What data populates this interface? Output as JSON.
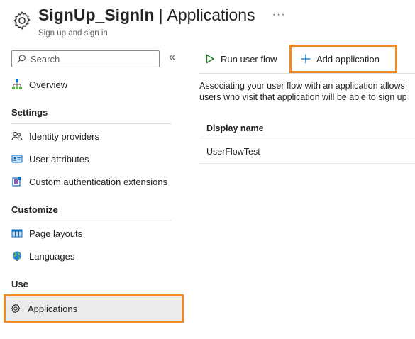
{
  "header": {
    "title": "SignUp_SignIn",
    "separator": "|",
    "page": "Applications",
    "more": "···",
    "subtitle": "Sign up and sign in"
  },
  "sidebar": {
    "search_placeholder": "Search",
    "collapse": "«",
    "items": {
      "overview": "Overview",
      "identity_providers": "Identity providers",
      "user_attributes": "User attributes",
      "custom_auth": "Custom authentication extensions",
      "page_layouts": "Page layouts",
      "languages": "Languages",
      "applications": "Applications"
    },
    "sections": {
      "settings": "Settings",
      "customize": "Customize",
      "use": "Use"
    }
  },
  "toolbar": {
    "run_user_flow": "Run user flow",
    "add_application": "Add application"
  },
  "main": {
    "description_line1": "Associating your user flow with an application allows",
    "description_line2": "users who visit that application will be able to sign up",
    "table": {
      "header": "Display name",
      "rows": [
        "UserFlowTest"
      ]
    }
  },
  "colors": {
    "highlight": "#f08a24",
    "accent": "#0f6cbd",
    "run_icon": "#107c10"
  },
  "icons": {
    "header": "gear-icon",
    "search": "search-icon",
    "overview": "sitemap-icon",
    "identity_providers": "people-icon",
    "user_attributes": "id-card-icon",
    "custom_auth": "extension-icon",
    "page_layouts": "layout-icon",
    "languages": "globe-icon",
    "applications": "gear-icon",
    "run_user_flow": "play-icon",
    "add_application": "plus-icon"
  }
}
